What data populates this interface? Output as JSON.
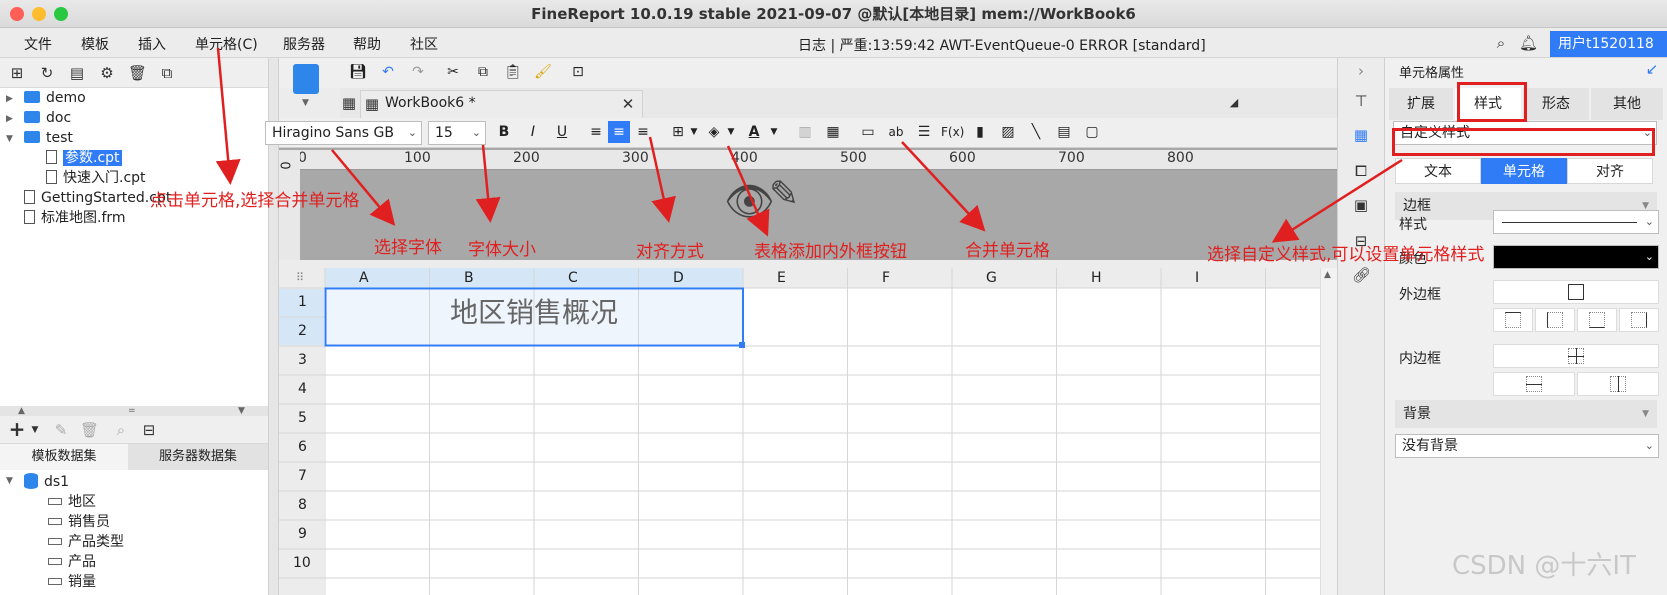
{
  "window": {
    "title": "FineReport 10.0.19 stable 2021-09-07 @默认[本地目录]   mem://WorkBook6"
  },
  "menu": {
    "items": [
      "文件",
      "模板",
      "插入",
      "单元格(C)",
      "服务器",
      "帮助",
      "社区"
    ],
    "log_status": "日志 | 严重:13:59:42 AWT-EventQueue-0 ERROR [standard]",
    "user": "用户t1520118"
  },
  "tree": {
    "items": [
      {
        "label": "demo",
        "type": "folder"
      },
      {
        "label": "doc",
        "type": "folder"
      },
      {
        "label": "test",
        "type": "folder"
      },
      {
        "label": "参数.cpt",
        "type": "file"
      },
      {
        "label": "快速入门.cpt",
        "type": "file"
      },
      {
        "label": "GettingStarted.cpt",
        "type": "file"
      },
      {
        "label": "标准地图.frm",
        "type": "file"
      }
    ]
  },
  "datasets": {
    "tabs": [
      "模板数据集",
      "服务器数据集"
    ],
    "root": "ds1",
    "fields": [
      "地区",
      "销售员",
      "产品类型",
      "产品",
      "销量"
    ]
  },
  "editor": {
    "tab_title": "WorkBook6 *",
    "font": "Hiragino Sans GB",
    "font_size": "15"
  },
  "ruler": {
    "marks": [
      "0",
      "100",
      "200",
      "300",
      "400",
      "500",
      "600",
      "700",
      "800"
    ],
    "vmark": "0"
  },
  "sheet": {
    "columns": [
      "A",
      "B",
      "C",
      "D",
      "E",
      "F",
      "G",
      "H",
      "I"
    ],
    "rows": [
      "1",
      "2",
      "3",
      "4",
      "5",
      "6",
      "7",
      "8",
      "9",
      "10"
    ],
    "merged_text": "地区销售概况"
  },
  "panel": {
    "title": "单元格属性",
    "tabs": [
      "扩展",
      "样式",
      "形态",
      "其他"
    ],
    "style_select": "自定义样式",
    "subtabs": [
      "文本",
      "单元格",
      "对齐"
    ],
    "border_section": "边框",
    "style_label": "样式",
    "color_label": "颜色",
    "outer_label": "外边框",
    "inner_label": "内边框",
    "bg_section": "背景",
    "bg_select": "没有背景",
    "color_value": "#000000"
  },
  "annotations": {
    "merge_cell_menu": "点击单元格,选择合并单元格",
    "font": "选择字体",
    "size": "字体大小",
    "align": "对齐方式",
    "border": "表格添加内外框按钮",
    "merge": "合并单元格",
    "custom_style": "选择自定义样式,可以设置单元格样式"
  },
  "watermark": "CSDN @十六IT",
  "accent": "#2f7cf6",
  "annotation_color": "#e02020"
}
